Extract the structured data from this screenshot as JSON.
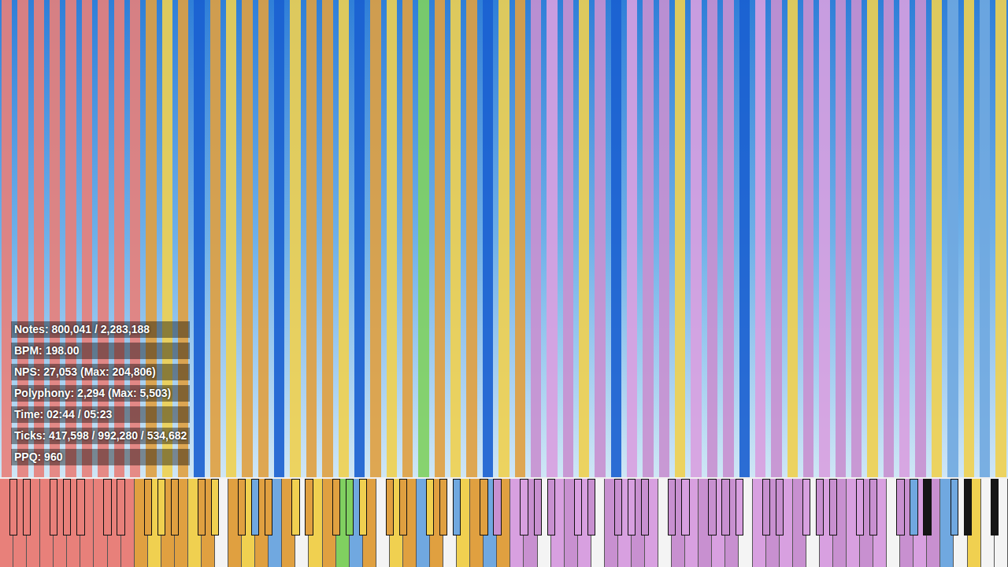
{
  "background": {
    "kind": "video-frame"
  },
  "stats": [
    "Notes: 800,041 / 2,283,188",
    "BPM: 198.00",
    "NPS: 27,053 (Max: 204,806)",
    "Polyphony: 2,294 (Max: 5,503)",
    "Time: 02:44 / 05:23",
    "Ticks: 417,598 / 992,280 / 534,682",
    "PPQ: 960"
  ],
  "note_columns": [
    {
      "color": "#e8807a"
    },
    {
      "color": "#e8807a"
    },
    {
      "color": "#e8807a"
    },
    {
      "color": "#e8807a"
    },
    {
      "color": "#e8807a"
    },
    {
      "color": "#e8807a"
    },
    {
      "color": "#e8807a"
    },
    {
      "color": "#e8807a"
    },
    {
      "color": "#e8807a"
    },
    {
      "color": "#e0a040"
    },
    {
      "color": "#f0d050"
    },
    {
      "color": "#e0a040"
    },
    {
      "color": "#1a5fd0"
    },
    {
      "color": "#e0a040"
    },
    {
      "color": "#f0d050"
    },
    {
      "color": "#e0a040"
    },
    {
      "color": "#e0a040"
    },
    {
      "color": "#1a5fd0"
    },
    {
      "color": "#f0d050"
    },
    {
      "color": "#e0a040"
    },
    {
      "color": "#e0a040"
    },
    {
      "color": "#f0d050"
    },
    {
      "color": "#1a5fd0"
    },
    {
      "color": "#e0a040"
    },
    {
      "color": "#f0d050"
    },
    {
      "color": "#e0a040"
    },
    {
      "color": "#80d060"
    },
    {
      "color": "#e0a040"
    },
    {
      "color": "#f0d050"
    },
    {
      "color": "#e0a040"
    },
    {
      "color": "#1a5fd0"
    },
    {
      "color": "#f0d050"
    },
    {
      "color": "#e0a040"
    },
    {
      "color": "#c890d0"
    },
    {
      "color": "#d8a0e0"
    },
    {
      "color": "#c890d0"
    },
    {
      "color": "#f0d050"
    },
    {
      "color": "#c890d0"
    },
    {
      "color": "#1a5fd0"
    },
    {
      "color": "#d8a0e0"
    },
    {
      "color": "#c890d0"
    },
    {
      "color": "#c890d0"
    },
    {
      "color": "#f0d050"
    },
    {
      "color": "#d8a0e0"
    },
    {
      "color": "#c890d0"
    },
    {
      "color": "#c890d0"
    },
    {
      "color": "#1a5fd0"
    },
    {
      "color": "#d8a0e0"
    },
    {
      "color": "#c890d0"
    },
    {
      "color": "#f0d050"
    },
    {
      "color": "#c890d0"
    },
    {
      "color": "#d8a0e0"
    },
    {
      "color": "#c890d0"
    },
    {
      "color": "#c890d0"
    },
    {
      "color": "#f0d050"
    },
    {
      "color": "#c890d0"
    },
    {
      "color": "#d8a0e0"
    },
    {
      "color": "#c890d0"
    },
    {
      "color": "#f0d050"
    },
    {
      "color": "#70a8e0"
    },
    {
      "color": "#f0d050"
    },
    {
      "color": "#70a8e0"
    },
    {
      "color": "#f0d050"
    }
  ],
  "white_keys": [
    {
      "pressed": true,
      "color": "#e8807a"
    },
    {
      "pressed": true,
      "color": "#e8807a"
    },
    {
      "pressed": true,
      "color": "#e8807a"
    },
    {
      "pressed": true,
      "color": "#e8807a"
    },
    {
      "pressed": true,
      "color": "#e8807a"
    },
    {
      "pressed": true,
      "color": "#e8807a"
    },
    {
      "pressed": true,
      "color": "#e8807a"
    },
    {
      "pressed": true,
      "color": "#e8807a"
    },
    {
      "pressed": true,
      "color": "#e8807a"
    },
    {
      "pressed": true,
      "color": "#e8807a"
    },
    {
      "pressed": true,
      "color": "#e0a040"
    },
    {
      "pressed": true,
      "color": "#f0d050"
    },
    {
      "pressed": true,
      "color": "#e0a040"
    },
    {
      "pressed": true,
      "color": "#e0a040"
    },
    {
      "pressed": true,
      "color": "#f0d050"
    },
    {
      "pressed": true,
      "color": "#e0a040"
    },
    {
      "pressed": false
    },
    {
      "pressed": true,
      "color": "#e0a040"
    },
    {
      "pressed": true,
      "color": "#f0d050"
    },
    {
      "pressed": true,
      "color": "#e0a040"
    },
    {
      "pressed": true,
      "color": "#70a8e0"
    },
    {
      "pressed": true,
      "color": "#e0a040"
    },
    {
      "pressed": false
    },
    {
      "pressed": true,
      "color": "#f0d050"
    },
    {
      "pressed": true,
      "color": "#e0a040"
    },
    {
      "pressed": true,
      "color": "#80d060"
    },
    {
      "pressed": true,
      "color": "#70a8e0"
    },
    {
      "pressed": true,
      "color": "#e0a040"
    },
    {
      "pressed": false
    },
    {
      "pressed": true,
      "color": "#f0d050"
    },
    {
      "pressed": true,
      "color": "#e0a040"
    },
    {
      "pressed": true,
      "color": "#70a8e0"
    },
    {
      "pressed": true,
      "color": "#e0a040"
    },
    {
      "pressed": false
    },
    {
      "pressed": true,
      "color": "#f0d050"
    },
    {
      "pressed": true,
      "color": "#e0a040"
    },
    {
      "pressed": true,
      "color": "#70a8e0"
    },
    {
      "pressed": true,
      "color": "#e0a040"
    },
    {
      "pressed": true,
      "color": "#d8a0e0"
    },
    {
      "pressed": true,
      "color": "#c890d0"
    },
    {
      "pressed": false
    },
    {
      "pressed": true,
      "color": "#d8a0e0"
    },
    {
      "pressed": true,
      "color": "#c890d0"
    },
    {
      "pressed": true,
      "color": "#d8a0e0"
    },
    {
      "pressed": false
    },
    {
      "pressed": true,
      "color": "#c890d0"
    },
    {
      "pressed": true,
      "color": "#d8a0e0"
    },
    {
      "pressed": true,
      "color": "#c890d0"
    },
    {
      "pressed": true,
      "color": "#d8a0e0"
    },
    {
      "pressed": false
    },
    {
      "pressed": true,
      "color": "#c890d0"
    },
    {
      "pressed": true,
      "color": "#d8a0e0"
    },
    {
      "pressed": true,
      "color": "#c890d0"
    },
    {
      "pressed": true,
      "color": "#d8a0e0"
    },
    {
      "pressed": true,
      "color": "#c890d0"
    },
    {
      "pressed": false
    },
    {
      "pressed": true,
      "color": "#d8a0e0"
    },
    {
      "pressed": true,
      "color": "#c890d0"
    },
    {
      "pressed": true,
      "color": "#d8a0e0"
    },
    {
      "pressed": true,
      "color": "#c890d0"
    },
    {
      "pressed": false
    },
    {
      "pressed": true,
      "color": "#d8a0e0"
    },
    {
      "pressed": true,
      "color": "#c890d0"
    },
    {
      "pressed": true,
      "color": "#d8a0e0"
    },
    {
      "pressed": true,
      "color": "#c890d0"
    },
    {
      "pressed": true,
      "color": "#d8a0e0"
    },
    {
      "pressed": false
    },
    {
      "pressed": true,
      "color": "#c890d0"
    },
    {
      "pressed": true,
      "color": "#d8a0e0"
    },
    {
      "pressed": true,
      "color": "#c890d0"
    },
    {
      "pressed": true,
      "color": "#70a8e0"
    },
    {
      "pressed": false
    },
    {
      "pressed": true,
      "color": "#f0d050"
    },
    {
      "pressed": false
    },
    {
      "pressed": false
    }
  ],
  "black_keys": [
    {
      "pressed": true,
      "color": "#e8807a"
    },
    {
      "pressed": true,
      "color": "#e8807a"
    },
    {
      "pressed": true,
      "color": "#e8807a"
    },
    {
      "pressed": true,
      "color": "#e8807a"
    },
    {
      "pressed": true,
      "color": "#e8807a"
    },
    {
      "pressed": true,
      "color": "#e8807a"
    },
    {
      "pressed": true,
      "color": "#e8807a"
    },
    {
      "pressed": true,
      "color": "#e0a040"
    },
    {
      "pressed": true,
      "color": "#f0d050"
    },
    {
      "pressed": true,
      "color": "#e0a040"
    },
    {
      "pressed": true,
      "color": "#e0a040"
    },
    {
      "pressed": true,
      "color": "#f0d050"
    },
    {
      "pressed": true,
      "color": "#e0a040"
    },
    {
      "pressed": true,
      "color": "#70a8e0"
    },
    {
      "pressed": true,
      "color": "#e0a040"
    },
    {
      "pressed": true,
      "color": "#f0d050"
    },
    {
      "pressed": true,
      "color": "#e0a040"
    },
    {
      "pressed": true,
      "color": "#e0a040"
    },
    {
      "pressed": true,
      "color": "#80d060"
    },
    {
      "pressed": true,
      "color": "#f0d050"
    },
    {
      "pressed": true,
      "color": "#e0a040"
    },
    {
      "pressed": true,
      "color": "#e0a040"
    },
    {
      "pressed": true,
      "color": "#f0d050"
    },
    {
      "pressed": true,
      "color": "#e0a040"
    },
    {
      "pressed": true,
      "color": "#70a8e0"
    },
    {
      "pressed": true,
      "color": "#e0a040"
    },
    {
      "pressed": true,
      "color": "#c890d0"
    },
    {
      "pressed": true,
      "color": "#d8a0e0"
    },
    {
      "pressed": true,
      "color": "#c890d0"
    },
    {
      "pressed": true,
      "color": "#c890d0"
    },
    {
      "pressed": true,
      "color": "#d8a0e0"
    },
    {
      "pressed": true,
      "color": "#c890d0"
    },
    {
      "pressed": true,
      "color": "#c890d0"
    },
    {
      "pressed": true,
      "color": "#d8a0e0"
    },
    {
      "pressed": true,
      "color": "#c890d0"
    },
    {
      "pressed": true,
      "color": "#c890d0"
    },
    {
      "pressed": true,
      "color": "#d8a0e0"
    },
    {
      "pressed": true,
      "color": "#c890d0"
    },
    {
      "pressed": true,
      "color": "#c890d0"
    },
    {
      "pressed": true,
      "color": "#d8a0e0"
    },
    {
      "pressed": true,
      "color": "#c890d0"
    },
    {
      "pressed": true,
      "color": "#c890d0"
    },
    {
      "pressed": true,
      "color": "#d8a0e0"
    },
    {
      "pressed": true,
      "color": "#c890d0"
    },
    {
      "pressed": true,
      "color": "#c890d0"
    },
    {
      "pressed": true,
      "color": "#d8a0e0"
    },
    {
      "pressed": true,
      "color": "#c890d0"
    },
    {
      "pressed": true,
      "color": "#c890d0"
    },
    {
      "pressed": true,
      "color": "#70a8e0"
    },
    {
      "pressed": false
    },
    {
      "pressed": true,
      "color": "#70a8e0"
    },
    {
      "pressed": false
    },
    {
      "pressed": false
    }
  ]
}
